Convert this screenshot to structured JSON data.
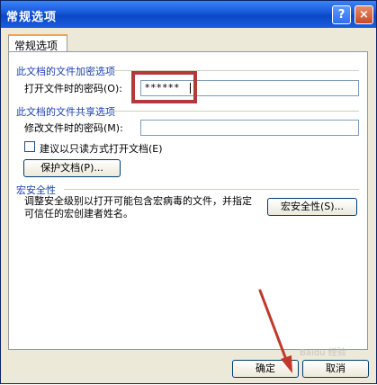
{
  "window": {
    "title": "常规选项",
    "help_symbol": "?",
    "close_symbol": "×"
  },
  "tab": {
    "label": "常规选项"
  },
  "encrypt": {
    "section_title": "此文档的文件加密选项",
    "open_password_label": "打开文件时的密码(O):",
    "open_password_value": "******"
  },
  "share": {
    "section_title": "此文档的文件共享选项",
    "modify_password_label": "修改文件时的密码(M):",
    "modify_password_value": "",
    "readonly_label": "建议以只读方式打开文档(E)",
    "protect_button": "保护文档(P)..."
  },
  "macro": {
    "section_title": "宏安全性",
    "description": "调整安全级别以打开可能包含宏病毒的文件，并指定可信任的宏创建者姓名。",
    "button": "宏安全性(S)..."
  },
  "footer": {
    "ok_button": "确定",
    "cancel_button": "取消"
  },
  "watermark": {
    "text": "Baidu 经验"
  },
  "colors": {
    "titlebar": "#0b47c7",
    "section_text": "#1a3fb0",
    "annotation": "#b23a3a"
  }
}
